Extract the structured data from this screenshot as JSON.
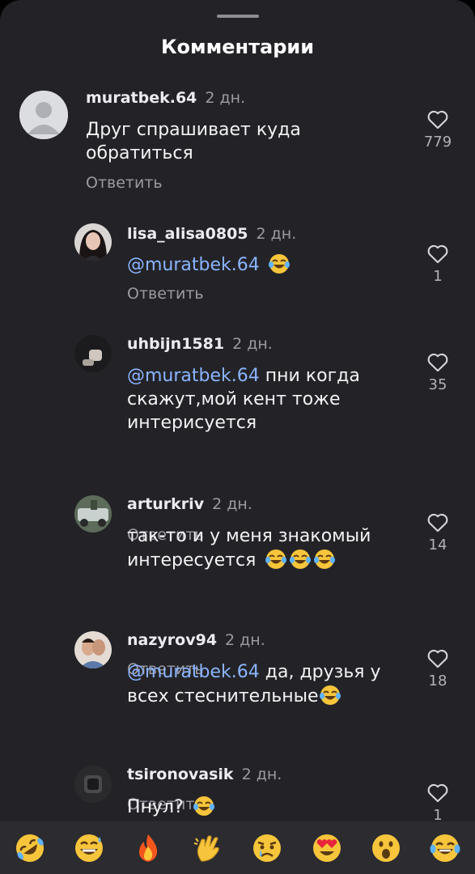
{
  "sheet": {
    "title": "Комментарии"
  },
  "comments": [
    {
      "username": "muratbek.64",
      "time": "2 дн.",
      "text": "Друг спрашивает куда обратиться",
      "lines": [
        "Друг спрашивает куда",
        "обратиться"
      ],
      "reply_label": "Ответить",
      "likes": "779"
    },
    {
      "username": "lisa_alisa0805",
      "time": "2 дн.",
      "mention": "@muratbek.64",
      "text": "",
      "reply_label": "Ответить",
      "likes": "1"
    },
    {
      "username": "uhbijn1581",
      "time": "2 дн.",
      "mention": "@muratbek.64",
      "text": "пни когда скажут,мой кент тоже интерисуется",
      "lines": [
        "пни когда",
        "скажут,мой кент тоже",
        "интерисуется"
      ],
      "reply_label": "Ответить",
      "likes": "35"
    },
    {
      "username": "arturkriv",
      "time": "2 дн.",
      "text": "так-то и у меня знакомый интересуется",
      "lines": [
        "так-то и у меня знакомый",
        "интересуется"
      ],
      "reply_label": "Ответить",
      "likes": "14"
    },
    {
      "username": "nazyrov94",
      "time": "2 дн.",
      "mention": "@muratbek.64",
      "text": "да, друзья у всех стеснительные",
      "lines": [
        "да, друзья у",
        "всех стеснительные"
      ],
      "reply_label": "Ответить",
      "likes": "18"
    },
    {
      "username": "tsironovasik",
      "time": "2 дн.",
      "text": "Пнул?",
      "likes": "1"
    }
  ],
  "quick_emojis": [
    "rolling-on-floor-laughing",
    "grinning-sweat",
    "fire",
    "clapping-hands",
    "crying-face",
    "heart-eyes",
    "astonished",
    "tears-of-joy"
  ],
  "colors": {
    "sheet": "#232327",
    "mention": "#8ab4ff",
    "emoji_yellow": "#f7c53b"
  }
}
